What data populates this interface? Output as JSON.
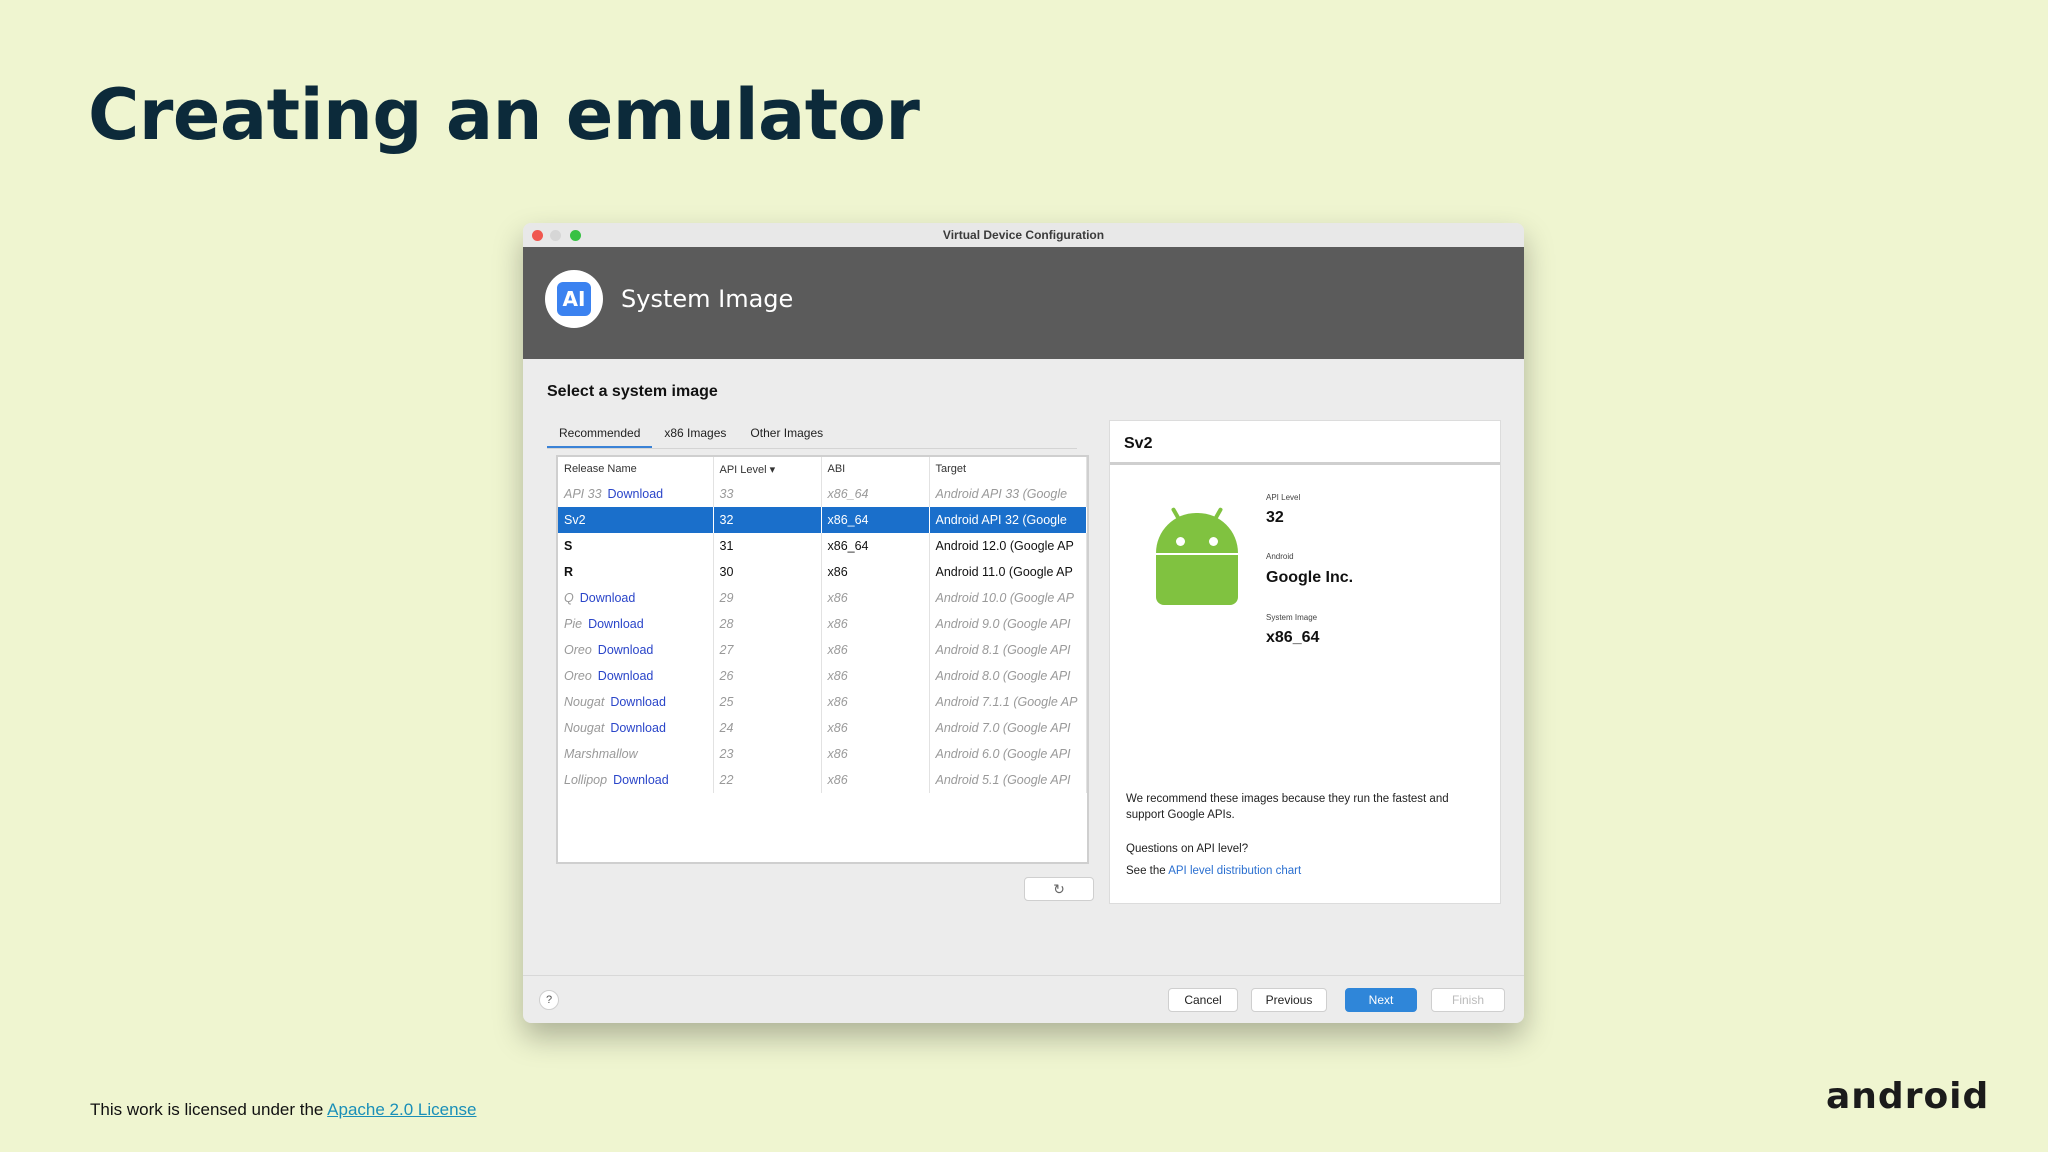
{
  "slide": {
    "title": "Creating an emulator",
    "footer_prefix": "This work is licensed under the ",
    "footer_link": "Apache 2.0 License",
    "logo_text": "android"
  },
  "window": {
    "title": "Virtual Device Configuration",
    "header_title": "System Image",
    "icon_glyph": "AI",
    "section_label": "Select a system image",
    "tabs": [
      {
        "label": "Recommended",
        "active": true
      },
      {
        "label": "x86 Images",
        "active": false
      },
      {
        "label": "Other Images",
        "active": false
      }
    ],
    "columns": [
      "Release Name",
      "API Level ▾",
      "ABI",
      "Target"
    ],
    "rows": [
      {
        "name": "API 33",
        "download": "Download",
        "api": "33",
        "abi": "x86_64",
        "target": "Android API 33 (Google",
        "state": "dim"
      },
      {
        "name": "Sv2",
        "download": "",
        "api": "32",
        "abi": "x86_64",
        "target": "Android API 32 (Google",
        "state": "sel"
      },
      {
        "name": "S",
        "download": "",
        "api": "31",
        "abi": "x86_64",
        "target": "Android 12.0 (Google AP",
        "state": "bold"
      },
      {
        "name": "R",
        "download": "",
        "api": "30",
        "abi": "x86",
        "target": "Android 11.0 (Google AP",
        "state": "bold"
      },
      {
        "name": "Q",
        "download": "Download",
        "api": "29",
        "abi": "x86",
        "target": "Android 10.0 (Google AP",
        "state": "dim"
      },
      {
        "name": "Pie",
        "download": "Download",
        "api": "28",
        "abi": "x86",
        "target": "Android 9.0 (Google API",
        "state": "dim"
      },
      {
        "name": "Oreo",
        "download": "Download",
        "api": "27",
        "abi": "x86",
        "target": "Android 8.1 (Google API",
        "state": "dim"
      },
      {
        "name": "Oreo",
        "download": "Download",
        "api": "26",
        "abi": "x86",
        "target": "Android 8.0 (Google API",
        "state": "dim"
      },
      {
        "name": "Nougat",
        "download": "Download",
        "api": "25",
        "abi": "x86",
        "target": "Android 7.1.1 (Google AP",
        "state": "dim"
      },
      {
        "name": "Nougat",
        "download": "Download",
        "api": "24",
        "abi": "x86",
        "target": "Android 7.0 (Google API",
        "state": "dim"
      },
      {
        "name": "Marshmallow",
        "download": "",
        "api": "23",
        "abi": "x86",
        "target": "Android 6.0 (Google API",
        "state": "dim"
      },
      {
        "name": "Lollipop",
        "download": "Download",
        "api": "22",
        "abi": "x86",
        "target": "Android 5.1 (Google API",
        "state": "dim"
      }
    ],
    "refresh_glyph": "↻",
    "detail": {
      "title": "Sv2",
      "api_label": "API Level",
      "api_value": "32",
      "android_label": "Android",
      "android_value": "Google Inc.",
      "image_label": "System Image",
      "image_value": "x86_64",
      "note": "We recommend these images because they run the fastest and support Google APIs.",
      "question": "Questions on API level?",
      "see_prefix": "See the ",
      "chart_link": "API level distribution chart"
    },
    "help_glyph": "?",
    "buttons": {
      "cancel": "Cancel",
      "previous": "Previous",
      "next": "Next",
      "finish": "Finish"
    }
  }
}
